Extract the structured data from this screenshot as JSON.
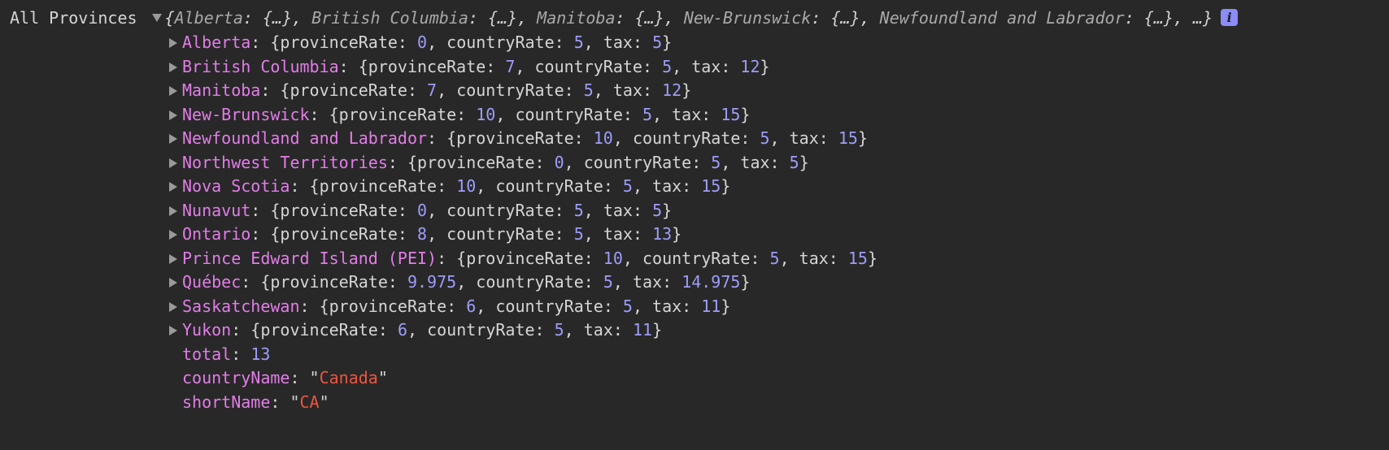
{
  "header": {
    "label": "All Provinces",
    "preview_keys": [
      "Alberta",
      "British Columbia",
      "Manitoba",
      "New-Brunswick",
      "Newfoundland and Labrador"
    ],
    "preview_value": "{…}",
    "preview_ellipsis": "…",
    "info_icon": "info-icon"
  },
  "provinces": [
    {
      "name": "Alberta",
      "provinceRate": "0",
      "countryRate": "5",
      "tax": "5"
    },
    {
      "name": "British Columbia",
      "provinceRate": "7",
      "countryRate": "5",
      "tax": "12"
    },
    {
      "name": "Manitoba",
      "provinceRate": "7",
      "countryRate": "5",
      "tax": "12"
    },
    {
      "name": "New-Brunswick",
      "provinceRate": "10",
      "countryRate": "5",
      "tax": "15"
    },
    {
      "name": "Newfoundland and Labrador",
      "provinceRate": "10",
      "countryRate": "5",
      "tax": "15"
    },
    {
      "name": "Northwest Territories",
      "provinceRate": "0",
      "countryRate": "5",
      "tax": "5"
    },
    {
      "name": "Nova Scotia",
      "provinceRate": "10",
      "countryRate": "5",
      "tax": "15"
    },
    {
      "name": "Nunavut",
      "provinceRate": "0",
      "countryRate": "5",
      "tax": "5"
    },
    {
      "name": "Ontario",
      "provinceRate": "8",
      "countryRate": "5",
      "tax": "13"
    },
    {
      "name": "Prince Edward Island (PEI)",
      "provinceRate": "10",
      "countryRate": "5",
      "tax": "15"
    },
    {
      "name": "Québec",
      "provinceRate": "9.975",
      "countryRate": "5",
      "tax": "14.975"
    },
    {
      "name": "Saskatchewan",
      "provinceRate": "6",
      "countryRate": "5",
      "tax": "11"
    },
    {
      "name": "Yukon",
      "provinceRate": "6",
      "countryRate": "5",
      "tax": "11"
    }
  ],
  "field_names": {
    "provinceRate": "provinceRate",
    "countryRate": "countryRate",
    "tax": "tax"
  },
  "extra": {
    "total_key": "total",
    "total_value": "13",
    "countryName_key": "countryName",
    "countryName_value": "Canada",
    "shortName_key": "shortName",
    "shortName_value": "CA"
  },
  "colors": {
    "background": "#282828",
    "key": "#e27de8",
    "number": "#9d9dfa",
    "string": "#ee5540",
    "text": "#d5d5d5"
  }
}
